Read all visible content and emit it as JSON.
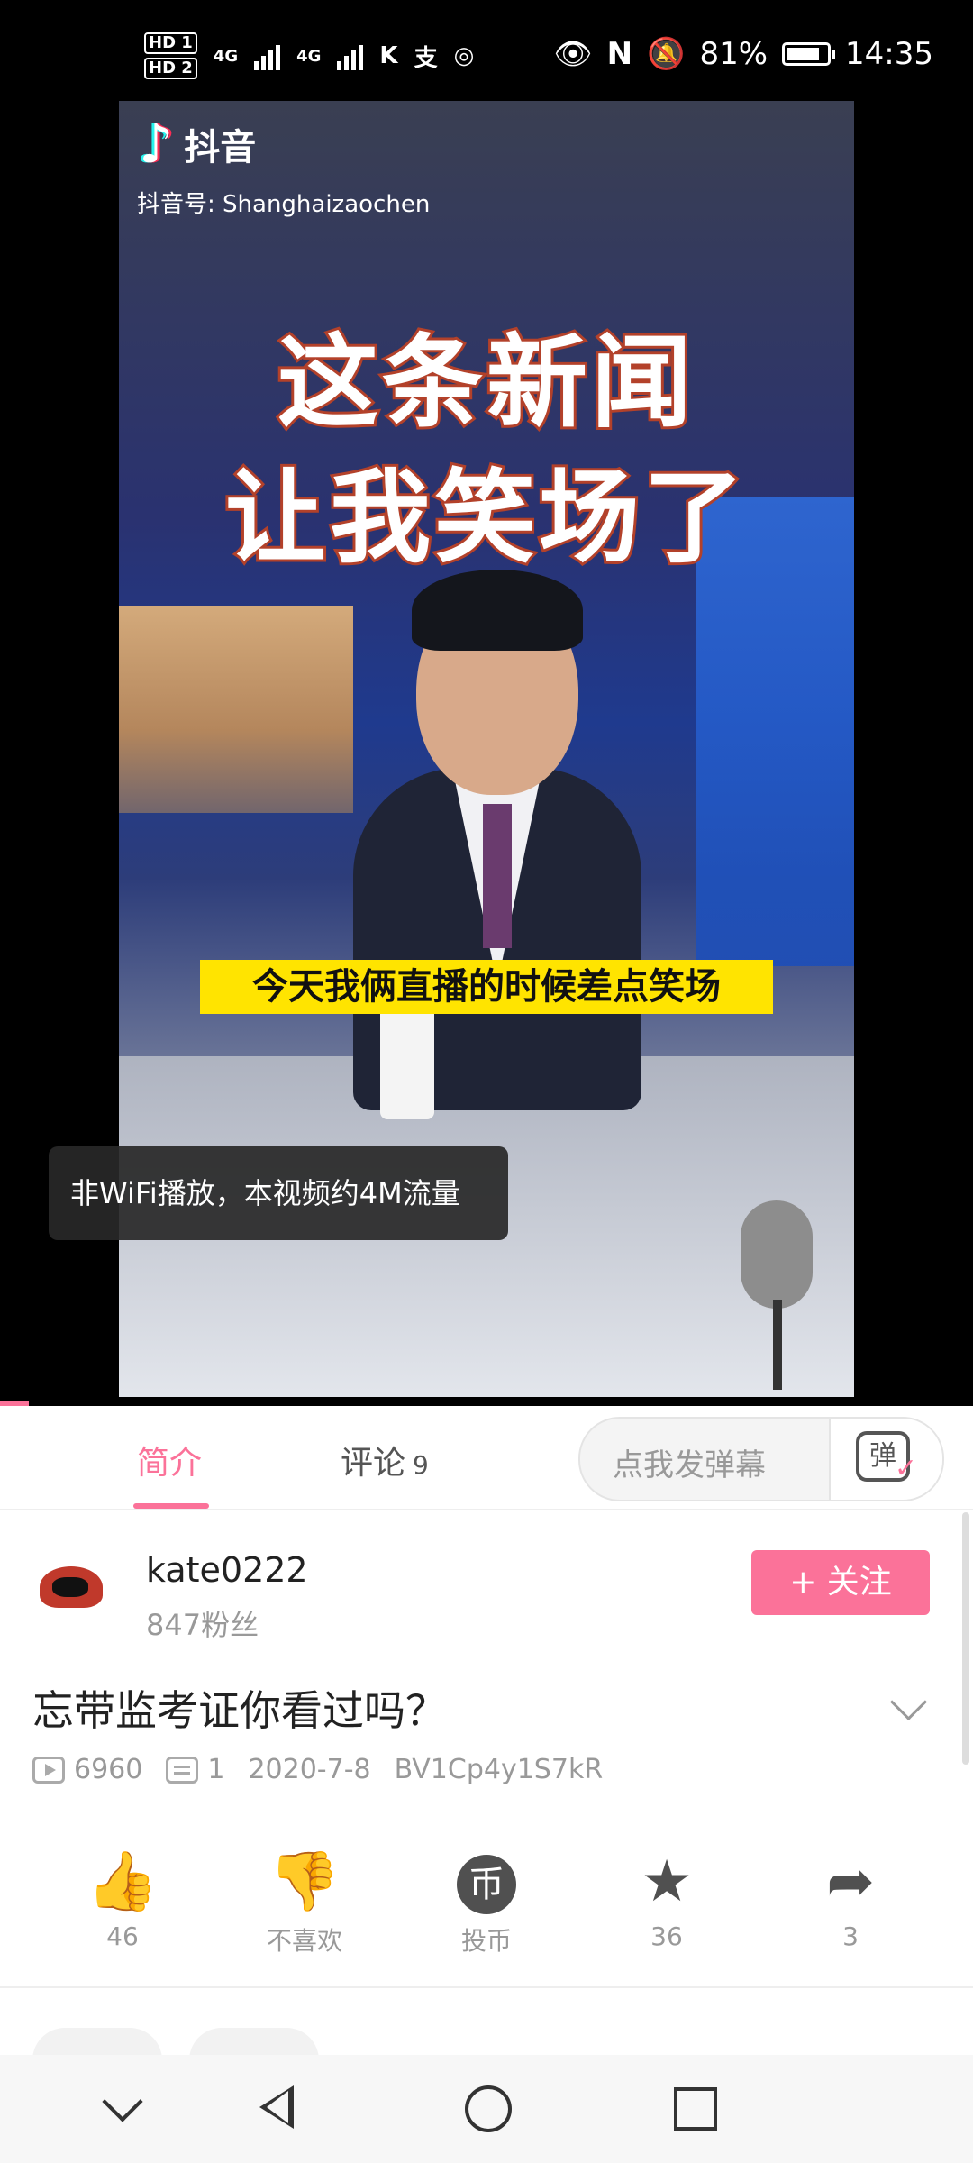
{
  "status_bar": {
    "hd1": "HD 1",
    "hd2": "HD 2",
    "net1": "4G",
    "net2": "4G",
    "battery_percent": "81%",
    "time": "14:35",
    "battery_level": 0.81
  },
  "video": {
    "tiktok_brand": "抖音",
    "tiktok_id": "抖音号: Shanghaizaochen",
    "headline_line1": "这条新闻",
    "headline_line2": "让我笑场了",
    "subtitle": "今天我俩直播的时候差点笑场",
    "toast": "非WiFi播放，本视频约4M流量",
    "progress_fraction": 0.03
  },
  "tabs": {
    "intro": "简介",
    "comments": "评论",
    "comments_count": "9",
    "danmu_placeholder": "点我发弹幕",
    "danmu_button": "弹"
  },
  "uploader": {
    "name": "kate0222",
    "fans": "847粉丝",
    "follow_label": "+ 关注"
  },
  "video_info": {
    "title": "忘带监考证你看过吗？",
    "views": "6960",
    "danmaku_count": "1",
    "date": "2020-7-8",
    "bvid": "BV1Cp4y1S7kR"
  },
  "actions": [
    {
      "icon": "thumbs-up-icon",
      "label": "46"
    },
    {
      "icon": "thumbs-down-icon",
      "label": "不喜欢"
    },
    {
      "icon": "coin-icon",
      "label": "投币"
    },
    {
      "icon": "star-icon",
      "label": "36"
    },
    {
      "icon": "share-icon",
      "label": "3"
    }
  ],
  "colors": {
    "accent": "#fb7299",
    "subtitle_bg": "#ffe400"
  }
}
